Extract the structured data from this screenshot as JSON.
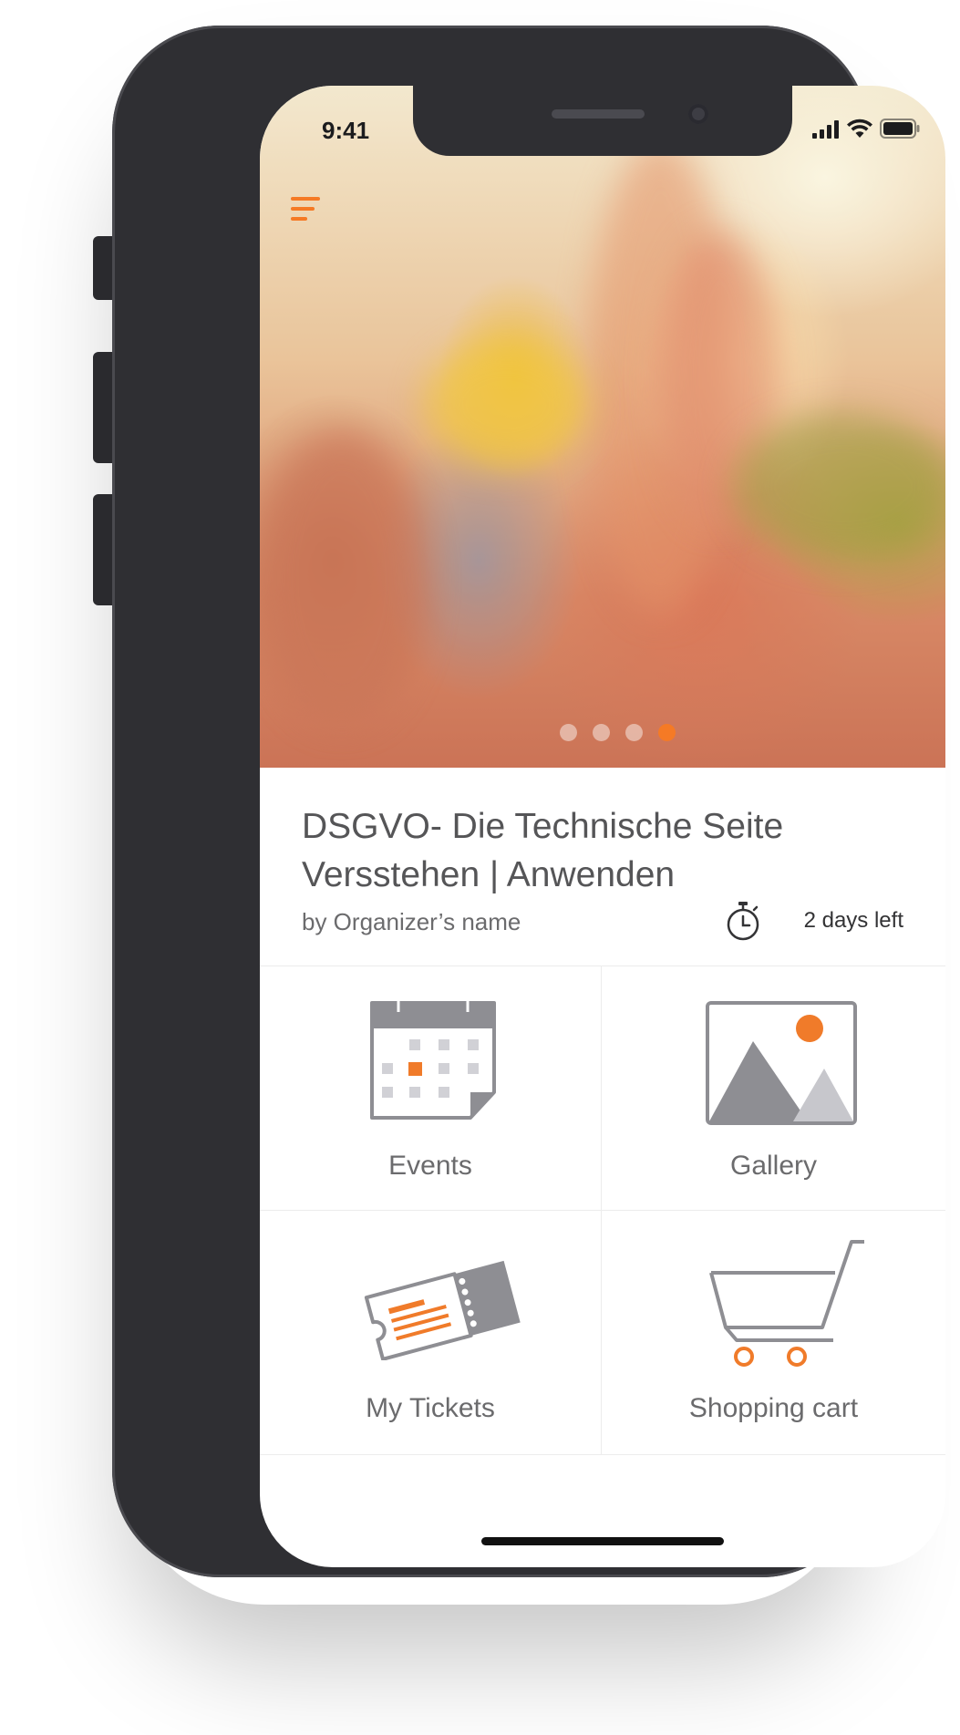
{
  "status_bar": {
    "time": "9:41"
  },
  "hero": {
    "carousel_dots": 4,
    "active_dot": 4
  },
  "event": {
    "title_line1": "DSGVO- Die Technische Seite",
    "title_line2": "Versstehen | Anwenden",
    "organizer": "by Organizer’s name",
    "days_left": "2 days left"
  },
  "tiles": [
    {
      "label": "Events",
      "icon": "calendar-icon"
    },
    {
      "label": "Gallery",
      "icon": "image-icon"
    },
    {
      "label": "My Tickets",
      "icon": "ticket-icon"
    },
    {
      "label": "Shopping cart",
      "icon": "cart-icon"
    }
  ],
  "colors": {
    "accent": "#f07b2a",
    "icon_gray": "#8e8e93",
    "text": "#6b6b6d"
  }
}
